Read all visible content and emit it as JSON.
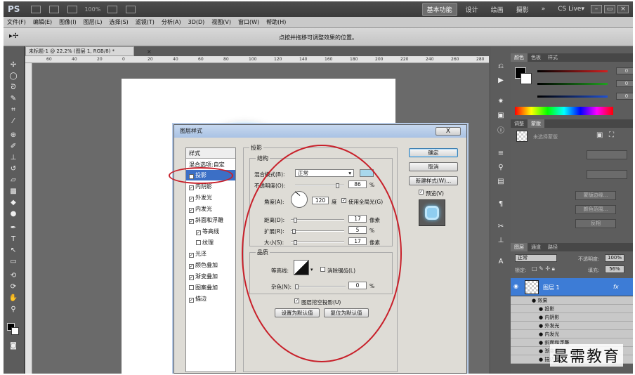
{
  "app": {
    "logo": "PS",
    "zoom_value": "100%",
    "workspaces": [
      "基本功能",
      "设计",
      "绘画",
      "摄影"
    ],
    "more": "»",
    "cslive": "CS Live▾"
  },
  "menu": [
    "文件(F)",
    "编辑(E)",
    "图像(I)",
    "图层(L)",
    "选择(S)",
    "滤镜(T)",
    "分析(A)",
    "3D(D)",
    "视图(V)",
    "窗口(W)",
    "帮助(H)"
  ],
  "options_bar": {
    "hint": "点按并拖移可调整效果的位置。"
  },
  "document": {
    "tab_title": "未标题-1 @ 22.2% (图层 1, RGB/8) *",
    "ruler_ticks": [
      "60",
      "40",
      "20",
      "0",
      "20",
      "40",
      "60",
      "80",
      "100",
      "120",
      "140",
      "160",
      "180",
      "200",
      "220",
      "240",
      "260",
      "280"
    ]
  },
  "color_panel": {
    "tabs": [
      "颜色",
      "色板",
      "样式"
    ],
    "values": [
      "0",
      "0",
      "0"
    ],
    "colors": {
      "r": "#d22020",
      "g": "#20a020",
      "b": "#2050d0"
    }
  },
  "adjust_panel": {
    "tabs": [
      "调整",
      "蒙版"
    ],
    "mask_title": "未选择蒙版",
    "buttons": [
      "蒙版边缘...",
      "颜色范围...",
      "反相"
    ]
  },
  "layers_panel": {
    "tabs": [
      "图层",
      "通道",
      "路径"
    ],
    "blend": "正常",
    "opacity_label": "不透明度:",
    "opacity": "100%",
    "lock_label": "锁定:",
    "fill_label": "填充:",
    "fill": "56%",
    "layer_name": "图层 1",
    "fx": "fx",
    "effects_label": "效果",
    "effects": [
      "投影",
      "内阴影",
      "外发光",
      "内发光",
      "斜面和浮雕",
      "渐变叠加",
      "描边"
    ]
  },
  "dialog": {
    "title": "图层样式",
    "close": "X",
    "styles_header": "样式",
    "blend_options": "混合选项:自定",
    "styles": [
      {
        "label": "投影",
        "checked": true,
        "selected": true
      },
      {
        "label": "内阴影",
        "checked": true
      },
      {
        "label": "外发光",
        "checked": true
      },
      {
        "label": "内发光",
        "checked": true
      },
      {
        "label": "斜面和浮雕",
        "checked": true
      },
      {
        "label": "等高线",
        "checked": true,
        "indent": true
      },
      {
        "label": "纹理",
        "checked": false,
        "indent": true
      },
      {
        "label": "光泽",
        "checked": true
      },
      {
        "label": "颜色叠加",
        "checked": true
      },
      {
        "label": "渐变叠加",
        "checked": true
      },
      {
        "label": "图案叠加",
        "checked": false
      },
      {
        "label": "描边",
        "checked": true
      }
    ],
    "section_title": "投影",
    "structure_title": "结构",
    "blend_mode_label": "混合模式(B):",
    "blend_mode": "正常",
    "opacity_label": "不透明度(O):",
    "opacity": "86",
    "angle_label": "角度(A):",
    "angle": "120",
    "degree": "度",
    "global_light": "使用全局光(G)",
    "distance_label": "距离(D):",
    "distance": "17",
    "spread_label": "扩展(R):",
    "spread": "5",
    "size_label": "大小(S):",
    "size": "17",
    "px": "像素",
    "pct": "%",
    "quality_title": "品质",
    "contour_label": "等高线:",
    "antialias": "消除锯齿(L)",
    "noise_label": "杂色(N):",
    "noise": "0",
    "knockout": "图层挖空投影(U)",
    "set_default": "设置为默认值",
    "reset_default": "复位为默认值",
    "ok": "确定",
    "cancel": "取消",
    "new_style": "新建样式(W)...",
    "preview": "预览(V)",
    "shadow_color": "#a8d8ec"
  },
  "watermark": "最需教育"
}
